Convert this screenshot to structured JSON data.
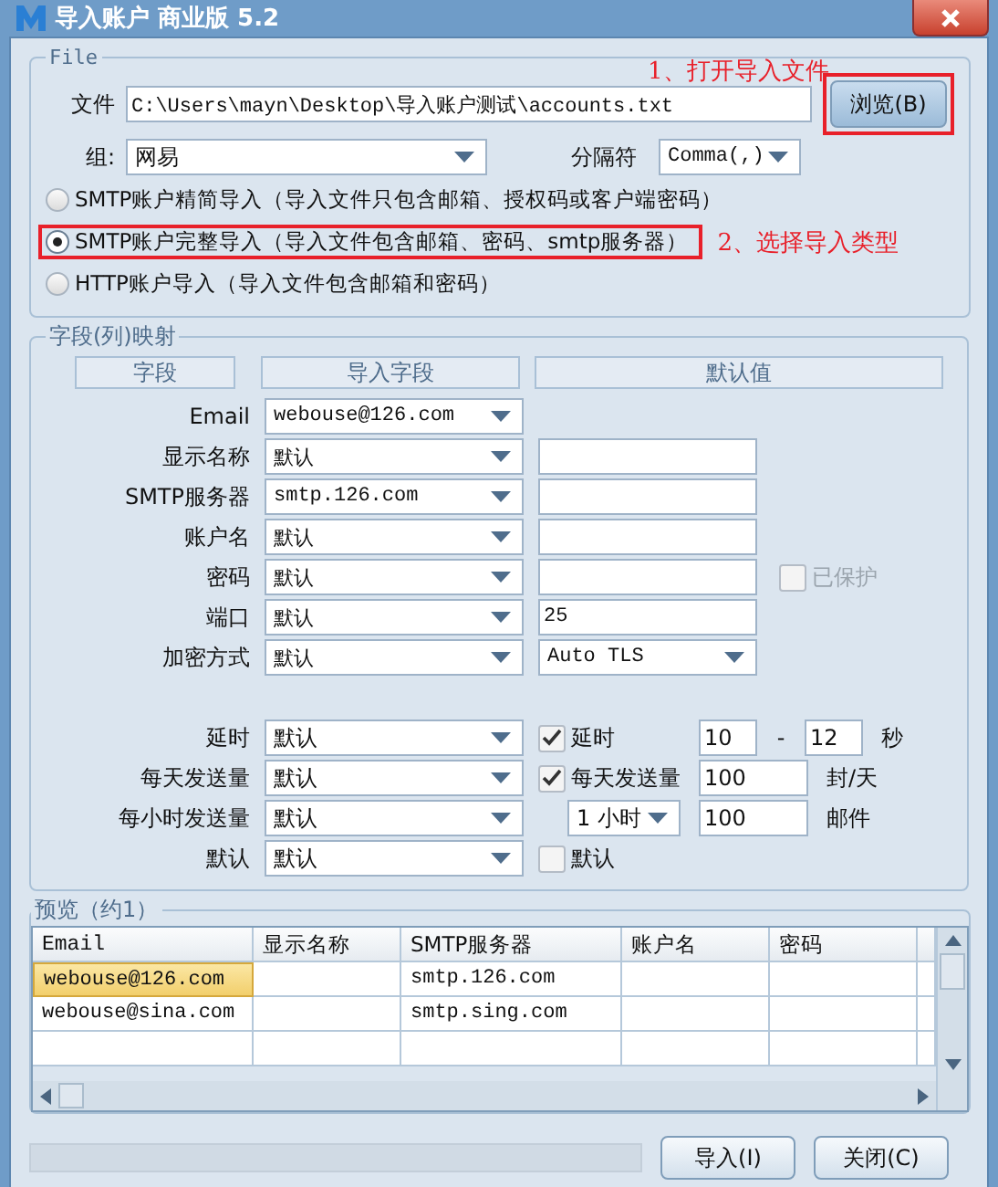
{
  "window": {
    "title": "导入账户 商业版 5.2"
  },
  "file_group": {
    "legend": "File",
    "file_label": "文件",
    "file_path": "C:\\Users\\mayn\\Desktop\\导入账户测试\\accounts.txt",
    "browse_button": {
      "label": "浏览(B)",
      "annotated": true
    },
    "note": "1、打开导入文件",
    "group_label": "组:",
    "group_value": "网易",
    "separator_label": "分隔符",
    "separator_value": "Comma(,)",
    "import_modes": [
      {
        "label": "SMTP账户精简导入（导入文件只包含邮箱、授权码或客户端密码）",
        "selected": false,
        "annotated": false
      },
      {
        "label": "SMTP账户完整导入（导入文件包含邮箱、密码、smtp服务器）",
        "selected": true,
        "annotated": true
      },
      {
        "label": "HTTP账户导入（导入文件包含邮箱和密码）",
        "selected": false,
        "annotated": false
      }
    ],
    "mode_note": "2、选择导入类型"
  },
  "mapping": {
    "legend": "字段(列)映射",
    "headers": [
      "字段",
      "导入字段",
      "默认值"
    ],
    "rows": [
      {
        "label": "Email",
        "import_field": "webouse@126.com",
        "default": {
          "kind": "none"
        }
      },
      {
        "label": "显示名称",
        "import_field": "默认",
        "default": {
          "kind": "input"
        }
      },
      {
        "label": "SMTP服务器",
        "import_field": "smtp.126.com",
        "default": {
          "kind": "input"
        }
      },
      {
        "label": "账户名",
        "import_field": "默认",
        "default": {
          "kind": "input"
        }
      },
      {
        "label": "密码",
        "import_field": "默认",
        "default": {
          "kind": "input"
        },
        "option": {
          "label": "已保护",
          "checked": false,
          "disabled": true
        }
      },
      {
        "label": "端口",
        "import_field": "默认",
        "default": {
          "kind": "input",
          "value": "25"
        }
      },
      {
        "label": "加密方式",
        "import_field": "默认",
        "default": {
          "kind": "select",
          "value": "Auto TLS"
        }
      }
    ],
    "limit_rows": [
      {
        "label": "延时",
        "import_field": "默认",
        "control": {
          "kind": "check",
          "label": "延时",
          "checked": true
        },
        "values": [
          "10",
          "12"
        ],
        "separator": "-",
        "unit": "秒"
      },
      {
        "label": "每天发送量",
        "import_field": "默认",
        "control": {
          "kind": "check",
          "label": "每天发送量",
          "checked": true
        },
        "values": [
          "100"
        ],
        "unit": "封/天"
      },
      {
        "label": "每小时发送量",
        "import_field": "默认",
        "control": {
          "kind": "select",
          "value": "1 小时"
        },
        "values": [
          "100"
        ],
        "unit": "邮件"
      },
      {
        "label": "默认",
        "import_field": "默认",
        "control": {
          "kind": "check",
          "label": "默认",
          "checked": false
        }
      }
    ]
  },
  "preview": {
    "legend": "预览（约1）",
    "columns": [
      "Email",
      "显示名称",
      "SMTP服务器",
      "账户名",
      "密码"
    ],
    "rows": [
      {
        "cells": [
          "webouse@126.com",
          "",
          "smtp.126.com",
          "",
          ""
        ],
        "selected": true
      },
      {
        "cells": [
          "webouse@sina.com",
          "",
          "smtp.sing.com",
          "",
          ""
        ],
        "selected": false
      }
    ]
  },
  "progress": {
    "level": 0
  },
  "buttons": [
    "导入(I)",
    "关闭(C)"
  ]
}
